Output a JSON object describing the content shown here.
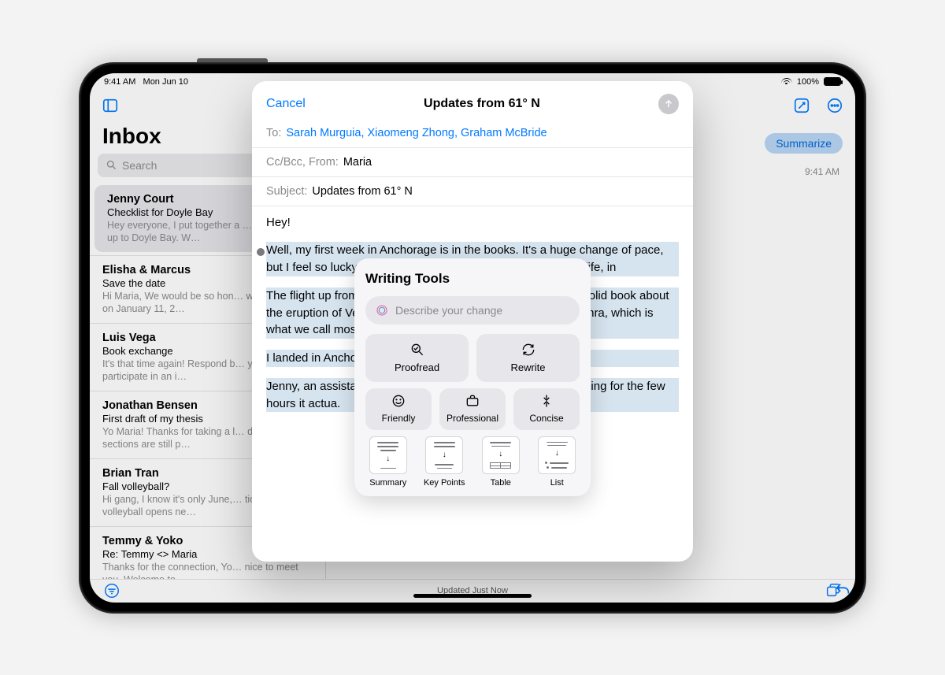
{
  "status": {
    "time": "9:41 AM",
    "date": "Mon Jun 10",
    "wifi_icon": "wifi",
    "battery_pct": "100%"
  },
  "app": {
    "sidebar_icon": "sidebar-icon",
    "inbox_title": "Inbox",
    "search_placeholder": "Search",
    "messages": [
      {
        "from": "Jenny Court",
        "subject": "Checklist for Doyle Bay",
        "preview": "Hey everyone, I put together a … for our trip up to Doyle Bay. W…"
      },
      {
        "from": "Elisha & Marcus",
        "subject": "Save the date",
        "preview": "Hi Maria, We would be so hon… would join us on January 11, 2…"
      },
      {
        "from": "Luis Vega",
        "subject": "Book exchange",
        "preview": "It's that time again! Respond b… you want to participate in an i…"
      },
      {
        "from": "Jonathan Bensen",
        "subject": "First draft of my thesis",
        "preview": "Yo Maria! Thanks for taking a l… draft. Some sections are still p…"
      },
      {
        "from": "Brian Tran",
        "subject": "Fall volleyball?",
        "preview": "Hi gang, I know it's only June,… tion for fall volleyball opens ne…"
      },
      {
        "from": "Temmy & Yoko",
        "subject": "Re: Temmy <> Maria",
        "preview": "Thanks for the connection, Yo… nice to meet you. Welcome to…"
      }
    ],
    "status_text": "Updated Just Now",
    "compose_icon": "compose",
    "more_icon": "ellipsis",
    "summarize_label": "Summarize",
    "msg_time": "9:41 AM",
    "reply_icon": "reply"
  },
  "compose": {
    "cancel": "Cancel",
    "title": "Updates from 61° N",
    "to_label": "To:",
    "to_value": "Sarah Murguia, Xiaomeng Zhong, Graham McBride",
    "ccbcc_label": "Cc/Bcc, From:",
    "ccbcc_value": "Maria",
    "subject_label": "Subject:",
    "subject_value": "Updates from 61° N",
    "body_hey": "Hey!",
    "body_p1": "Well, my first week in Anchorage is in the books. It's a huge change of pace, but I feel so lucky to have la                                                                           this was the longest week of my life, in",
    "body_p2": "The flight up from                                                               of the flight reading. I've been on a hist                                                              tty solid book about the eruption of Ve                                                              und Pompeii. It's a little dry at points                                                               rd: tephra, which is what we call most                                                               erupts. Let me know if you find a way t",
    "body_p3": "I landed in Anchor                                                              ould still be out, it was so trippy to s",
    "body_p4": "Jenny, an assistar                                                              e airport. She told me the first thing                                                               ly sleeping for the few hours it actua."
  },
  "wt": {
    "title": "Writing Tools",
    "input_placeholder": "Describe your change",
    "proofread": "Proofread",
    "rewrite": "Rewrite",
    "friendly": "Friendly",
    "professional": "Professional",
    "concise": "Concise",
    "summary": "Summary",
    "keypoints": "Key Points",
    "table": "Table",
    "list": "List"
  }
}
